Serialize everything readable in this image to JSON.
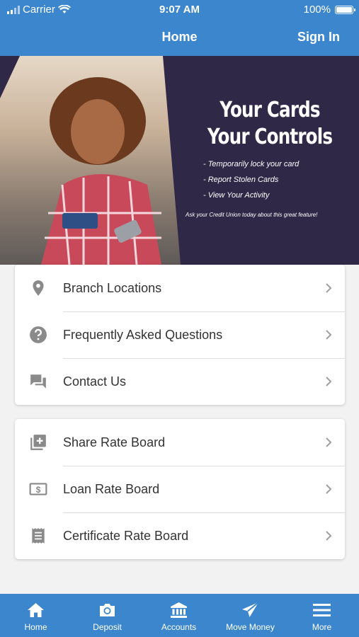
{
  "status_bar": {
    "carrier": "Carrier",
    "time": "9:07 AM",
    "battery": "100%"
  },
  "nav": {
    "title": "Home",
    "sign_in": "Sign In"
  },
  "banner": {
    "headline_line1": "Your Cards",
    "headline_line2": "Your Controls",
    "bullets": [
      "- Temporarily lock your card",
      "- Report Stolen Cards",
      "- View Your Activity"
    ],
    "note": "Ask your Credit Union today about this great feature!"
  },
  "menu_group1": [
    {
      "label": "Branch Locations",
      "icon": "location-pin-icon"
    },
    {
      "label": "Frequently Asked Questions",
      "icon": "question-circle-icon"
    },
    {
      "label": "Contact Us",
      "icon": "chat-icon"
    }
  ],
  "menu_group2": [
    {
      "label": "Share Rate Board",
      "icon": "add-stack-icon"
    },
    {
      "label": "Loan Rate Board",
      "icon": "dollar-bill-icon"
    },
    {
      "label": "Certificate Rate Board",
      "icon": "receipt-icon"
    }
  ],
  "tabs": [
    {
      "label": "Home",
      "icon": "home-icon"
    },
    {
      "label": "Deposit",
      "icon": "camera-icon"
    },
    {
      "label": "Accounts",
      "icon": "bank-icon"
    },
    {
      "label": "Move Money",
      "icon": "send-icon"
    },
    {
      "label": "More",
      "icon": "menu-icon"
    }
  ],
  "colors": {
    "primary": "#3b86cc",
    "banner_bg": "#2f2846",
    "icon_gray": "#8a8a8a",
    "text": "#333333"
  }
}
